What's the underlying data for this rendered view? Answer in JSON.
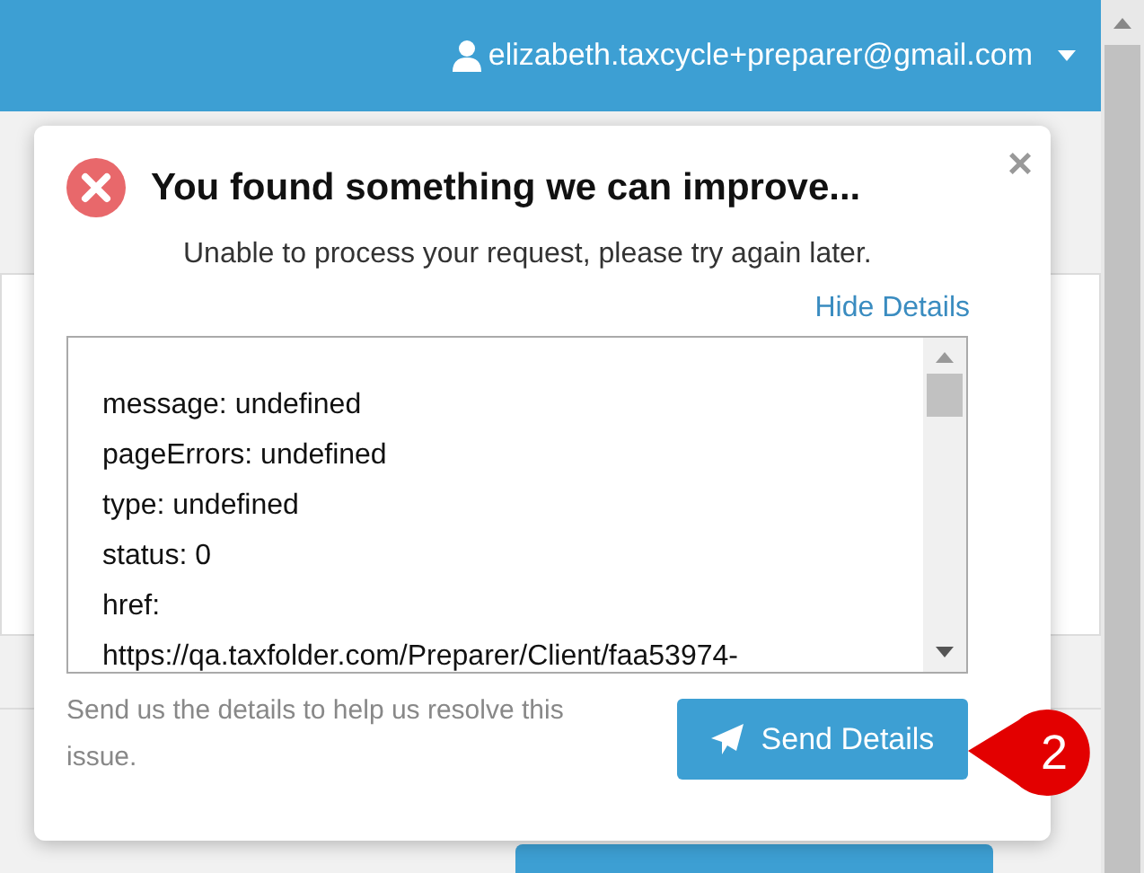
{
  "header": {
    "user": "elizabeth.taxcycle+preparer@gmail.com"
  },
  "dialog": {
    "title": "You found something we can improve...",
    "message": "Unable to process your request, please try again later.",
    "close": "×",
    "details_link": "Hide Details",
    "details": [
      "message: undefined",
      "pageErrors: undefined",
      "type: undefined",
      "status: 0",
      "href:",
      "https://qa.taxfolder.com/Preparer/Client/faa53974-"
    ],
    "hint": "Send us the details to help us resolve this issue.",
    "button": "Send Details"
  },
  "callout": {
    "label": "2"
  }
}
